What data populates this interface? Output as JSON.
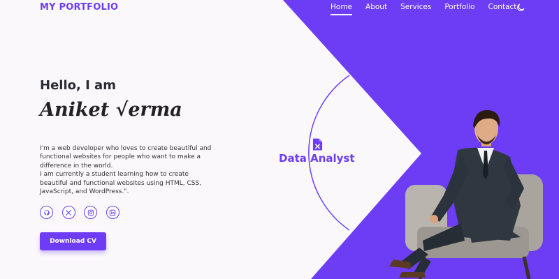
{
  "header": {
    "logo": "MY PORTFOLIO",
    "nav": [
      {
        "label": "Home",
        "active": true
      },
      {
        "label": "About",
        "active": false
      },
      {
        "label": "Services",
        "active": false
      },
      {
        "label": "Portfolio",
        "active": false
      },
      {
        "label": "Contact",
        "active": false
      }
    ],
    "theme_toggle_icon": "moon-icon"
  },
  "hero": {
    "greeting": "Hello, I am",
    "name": "Aniket √erma",
    "bio_line1": "I'm a web developer who loves to create beautiful and functional websites for people who want to make a difference in the world.",
    "bio_line2": "I am currently a student learning how to create beautiful and functional websites using HTML, CSS, JavaScript, and WordPress.\".",
    "socials": [
      {
        "icon": "github-icon"
      },
      {
        "icon": "x-icon"
      },
      {
        "icon": "instagram-icon"
      },
      {
        "icon": "linkedin-icon"
      }
    ],
    "cta_label": "Download CV"
  },
  "role": {
    "icon": "excel-file-icon",
    "label": "Data Analyst"
  },
  "colors": {
    "accent": "#6d3df5",
    "background": "#faf8fb"
  }
}
